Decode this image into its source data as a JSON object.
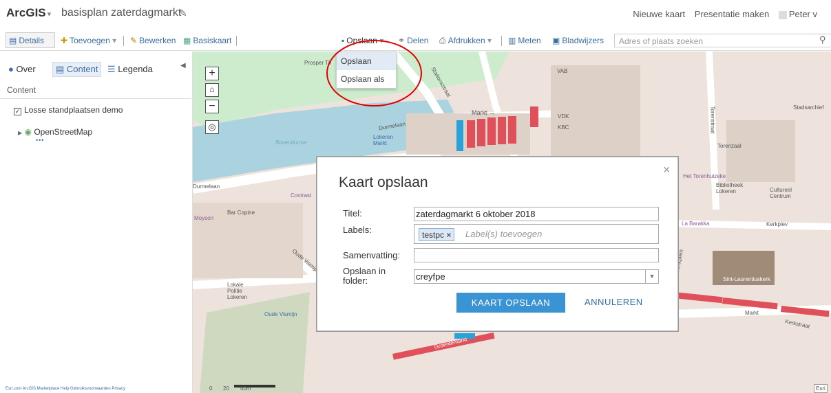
{
  "app": {
    "brand": "ArcGIS",
    "map_title": "basisplan zaterdagmarkt"
  },
  "top_links": {
    "new_map": "Nieuwe kaart",
    "presentation": "Presentatie maken",
    "user": "Peter v"
  },
  "toolbar": {
    "details": "Details",
    "add": "Toevoegen",
    "edit": "Bewerken",
    "basemap": "Basiskaart",
    "save": "Opslaan",
    "share": "Delen",
    "print": "Afdrukken",
    "measure": "Meten",
    "bookmarks": "Bladwijzers",
    "search_placeholder": "Adres of plaats zoeken"
  },
  "save_menu": {
    "items": [
      "Opslaan",
      "Opslaan als"
    ]
  },
  "sidebar": {
    "tabs": [
      "Over",
      "Content",
      "Legenda"
    ],
    "heading": "Content",
    "layers": [
      "Losse standplaatsen demo",
      "OpenStreetMap"
    ],
    "more": "•••"
  },
  "footer": "Esri.com  ArcGIS Marketplace  Help  Gebruiksvoorwaarden  Privacy",
  "map_labels": {
    "prosper": "Prosper Th",
    "statie": "Stationsstraat",
    "markt": "Markt",
    "markt2": "Markt →",
    "durme": "Durmelaan",
    "bovendurme": "Bovendurme",
    "lokeren_markt": "Lokeren Markt",
    "stadsarchief": "Stadsarchief",
    "torenzaal": "Torenzaal",
    "torenstraat": "Torenstraat",
    "bib": "Bibliotheek Lokeren",
    "cultureel": "Cultureel Centrum",
    "kerkplein": "Kerkplein",
    "kerkplev": "Kerkplev",
    "kerk": "Sint-Laurentiuskerk",
    "kerkstraat": "Kerkstraat",
    "barakka": "La Barakka",
    "torenhuis": "Het Torenhuizeke",
    "bar_copine": "Bar Copine",
    "oude_vismijn": "Oude Vismijn",
    "oude_vismijn2": "Oude Vismijn",
    "groentemarkt": "Groentemarkt",
    "moyson": "Moyson",
    "lokale_politie": "Lokale Politie Lokeren",
    "contrast": "Contrast",
    "vab": "VAB",
    "vdk": "VDK",
    "kbc": "KBC",
    "esri": "Esri",
    "scale0": "0",
    "scale20": "20",
    "scale40": "40m"
  },
  "modal": {
    "title": "Kaart opslaan",
    "close": "×",
    "title_label": "Titel:",
    "title_value": "zaterdagmarkt 6 oktober 2018",
    "labels_label": "Labels:",
    "tag": "testpc",
    "tag_remove": "×",
    "tags_placeholder": "Label(s) toevoegen",
    "summary_label": "Samenvatting:",
    "summary_value": "",
    "folder_label": "Opslaan in folder:",
    "folder_value": "creyfpe",
    "save_button": "KAART OPSLAAN",
    "cancel_button": "ANNULEREN"
  }
}
